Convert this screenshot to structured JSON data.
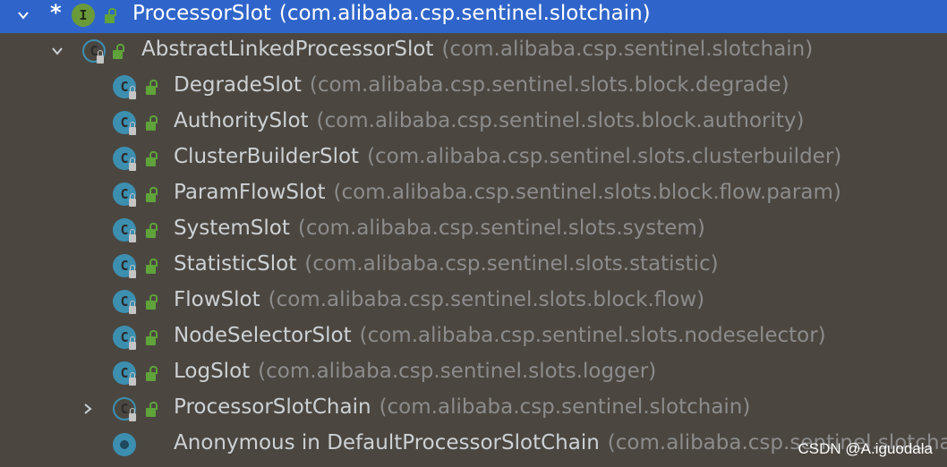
{
  "tree": {
    "rows": [
      {
        "name": "ProcessorSlot",
        "pkg": "(com.alibaba.csp.sentinel.slotchain)",
        "kind": "interface-icon",
        "icon_letter": "I",
        "expander": "chevron-down-icon"
      },
      {
        "name": "AbstractLinkedProcessorSlot",
        "pkg": "(com.alibaba.csp.sentinel.slotchain)",
        "kind": "abstract-class-icon",
        "icon_letter": "C",
        "expander": "chevron-down-icon"
      },
      {
        "name": "DegradeSlot",
        "pkg": "(com.alibaba.csp.sentinel.slots.block.degrade)",
        "kind": "class-icon",
        "icon_letter": "C"
      },
      {
        "name": "AuthoritySlot",
        "pkg": "(com.alibaba.csp.sentinel.slots.block.authority)",
        "kind": "class-icon",
        "icon_letter": "C"
      },
      {
        "name": "ClusterBuilderSlot",
        "pkg": "(com.alibaba.csp.sentinel.slots.clusterbuilder)",
        "kind": "class-icon",
        "icon_letter": "C"
      },
      {
        "name": "ParamFlowSlot",
        "pkg": "(com.alibaba.csp.sentinel.slots.block.flow.param)",
        "kind": "class-icon",
        "icon_letter": "C"
      },
      {
        "name": "SystemSlot",
        "pkg": "(com.alibaba.csp.sentinel.slots.system)",
        "kind": "class-icon",
        "icon_letter": "C"
      },
      {
        "name": "StatisticSlot",
        "pkg": "(com.alibaba.csp.sentinel.slots.statistic)",
        "kind": "class-icon",
        "icon_letter": "C"
      },
      {
        "name": "FlowSlot",
        "pkg": "(com.alibaba.csp.sentinel.slots.block.flow)",
        "kind": "class-icon",
        "icon_letter": "C"
      },
      {
        "name": "NodeSelectorSlot",
        "pkg": "(com.alibaba.csp.sentinel.slots.nodeselector)",
        "kind": "class-icon",
        "icon_letter": "C"
      },
      {
        "name": "LogSlot",
        "pkg": "(com.alibaba.csp.sentinel.slots.logger)",
        "kind": "class-icon",
        "icon_letter": "C"
      },
      {
        "name": "ProcessorSlotChain",
        "pkg": "(com.alibaba.csp.sentinel.slotchain)",
        "kind": "abstract-class-icon",
        "icon_letter": "C",
        "expander": "chevron-right-icon"
      },
      {
        "name": "Anonymous in DefaultProcessorSlotChain",
        "pkg": "(com.alibaba.csp.sentinel.slotchain)",
        "kind": "anonymous-class-icon",
        "icon_letter": ""
      }
    ],
    "selected_star": "*"
  },
  "watermark": "CSDN @A.iguodala",
  "colors": {
    "background": "#4b4740",
    "selection": "#2f65ca",
    "package_text": "#8c8c8c",
    "class_icon": "#3d8fb0",
    "interface_icon": "#6a9a3a",
    "public_lock": "#5fa33a"
  }
}
